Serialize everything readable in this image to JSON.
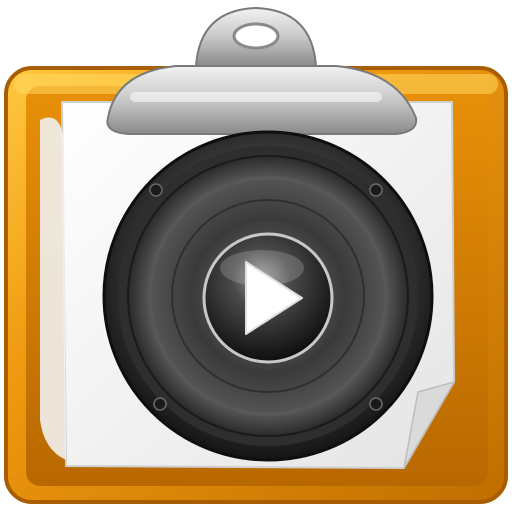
{
  "icon": {
    "name": "clipboard-audio-player-icon",
    "description_parts": [
      "clipboard-board",
      "paper-sheet",
      "metal-clip",
      "speaker-cone",
      "play-button"
    ],
    "colors": {
      "board_outer": "#C87700",
      "board_mid": "#F0A010",
      "board_highlight": "#FFD04A",
      "paper": "#F6F6F6",
      "clip_light": "#E8E8E8",
      "clip_dark": "#8E8E8E",
      "speaker_rim": "#2A2A2A",
      "speaker_cone": "#3C3C3C",
      "dust_cap": "#1A1A1A",
      "play_glyph": "#FFFFFF"
    }
  }
}
